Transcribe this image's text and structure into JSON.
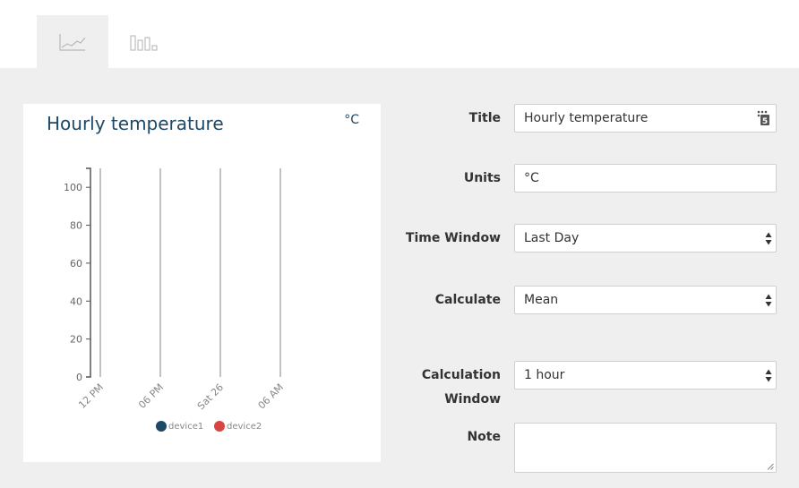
{
  "tabs": [
    {
      "name": "line-chart-tab",
      "icon": "line-chart-icon",
      "active": true
    },
    {
      "name": "bar-chart-tab",
      "icon": "bar-chart-icon",
      "active": false
    }
  ],
  "chart": {
    "title": "Hourly temperature",
    "units": "°C"
  },
  "chart_data": {
    "type": "line",
    "title": "Hourly temperature",
    "units": "°C",
    "y_ticks": [
      "0",
      "20",
      "40",
      "60",
      "80",
      "100"
    ],
    "x_ticks": [
      "12 PM",
      "06 PM",
      "Sat 26",
      "06 AM"
    ],
    "ylim": [
      0,
      110
    ],
    "series": [
      {
        "name": "device1",
        "color": "#1d4866",
        "values": []
      },
      {
        "name": "device2",
        "color": "#d64541",
        "values": []
      }
    ],
    "legend": "bottom-center",
    "grid": "vertical"
  },
  "form": {
    "title_label": "Title",
    "title_value": "Hourly temperature",
    "units_label": "Units",
    "units_value": "°C",
    "time_window_label": "Time Window",
    "time_window_value": "Last Day",
    "calculate_label": "Calculate",
    "calculate_value": "Mean",
    "calc_window_label_1": "Calculation",
    "calc_window_label_2": "Window",
    "calc_window_value": "1 hour",
    "note_label": "Note",
    "note_value": "",
    "calendar_icon_text": "5"
  }
}
